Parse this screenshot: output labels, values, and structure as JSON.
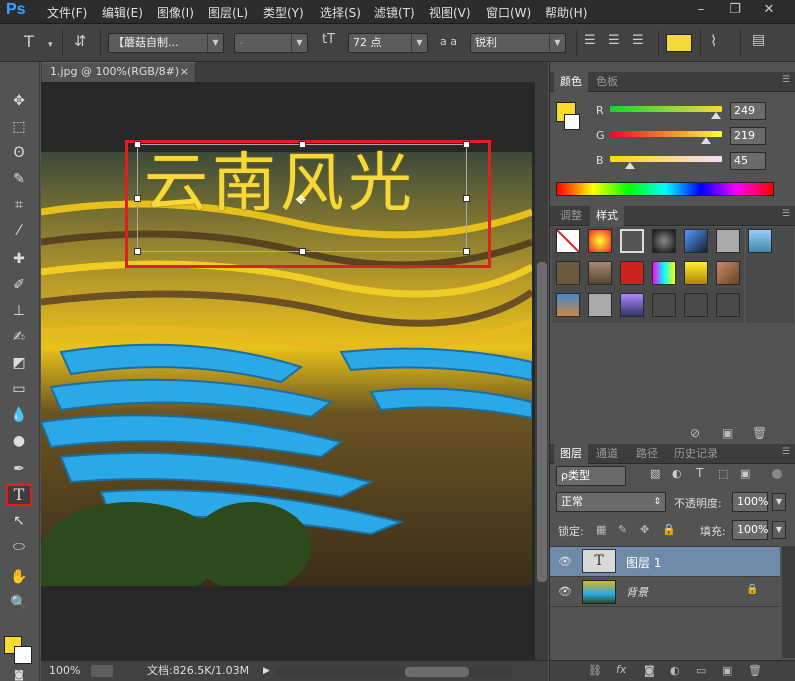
{
  "app": {
    "logo": "Ps"
  },
  "menu": [
    "文件(F)",
    "编辑(E)",
    "图像(I)",
    "图层(L)",
    "类型(Y)",
    "选择(S)",
    "滤镜(T)",
    "视图(V)",
    "窗口(W)",
    "帮助(H)"
  ],
  "options": {
    "font_family": "【蘑菇自制...",
    "font_style": "-",
    "font_size": "72 点",
    "aa_label": "a a",
    "antialias": "锐利",
    "text_color": "#f5d938"
  },
  "document": {
    "tab_title": "1.jpg @ 100%(RGB/8#)",
    "tab_close": "×",
    "overlay_text": "云南风光",
    "zoom": "100%",
    "doc_info": "文档:826.5K/1.03M"
  },
  "color_panel": {
    "tabs": [
      "颜色",
      "色板"
    ],
    "channels": [
      {
        "label": "R",
        "value": "249"
      },
      {
        "label": "G",
        "value": "219"
      },
      {
        "label": "B",
        "value": "45"
      }
    ],
    "foreground": "#f9db2d"
  },
  "styles_panel": {
    "tabs": [
      "调整",
      "样式"
    ]
  },
  "layers_panel": {
    "tabs": [
      "图层",
      "通道",
      "路径",
      "历史记录"
    ],
    "filter_kind": "ρ类型",
    "blend_mode": "正常",
    "opacity_label": "不透明度:",
    "opacity": "100%",
    "lock_label": "锁定:",
    "fill_label": "填充:",
    "fill": "100%",
    "layers": [
      {
        "name": "图层 1",
        "thumb": "T",
        "selected": true
      },
      {
        "name": "背景",
        "thumb": "",
        "selected": false
      }
    ]
  }
}
